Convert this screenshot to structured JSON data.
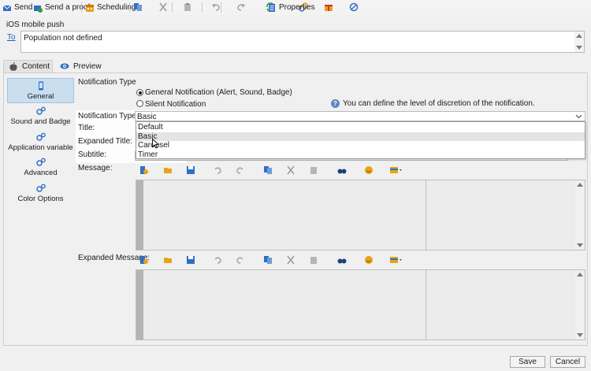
{
  "toolbar": {
    "send": "Send",
    "send_proof": "Send a proof",
    "scheduling": "Scheduling",
    "properties": "Properties"
  },
  "section_title": "iOS mobile push",
  "to": {
    "link": "To",
    "value": "Population not defined"
  },
  "tabs": [
    {
      "label": "Content"
    },
    {
      "label": "Preview"
    }
  ],
  "sidebar": {
    "items": [
      {
        "label": "General"
      },
      {
        "label": "Sound and Badge"
      },
      {
        "label": "Application variable"
      },
      {
        "label": "Advanced"
      },
      {
        "label": "Color Options"
      }
    ]
  },
  "notification": {
    "group_title": "Notification Type",
    "radio_general": "General Notification (Alert, Sound, Badge)",
    "radio_silent": "Silent Notification",
    "info_text": "You can define the level of discretion of the notification.",
    "type_label": "Notification Type:",
    "type_value": "Basic",
    "title_label": "Title:",
    "expanded_title_label": "Expanded Title:",
    "subtitle_label": "Subtitle:",
    "message_label": "Message:",
    "expanded_message_label": "Expanded Message:",
    "options": [
      "Default",
      "Basic",
      "Carousel",
      "Timer"
    ]
  },
  "footer": {
    "save": "Save",
    "cancel": "Cancel"
  },
  "colors": {
    "accent": "#1a5bd1",
    "selected_bg": "#c9dff0"
  }
}
